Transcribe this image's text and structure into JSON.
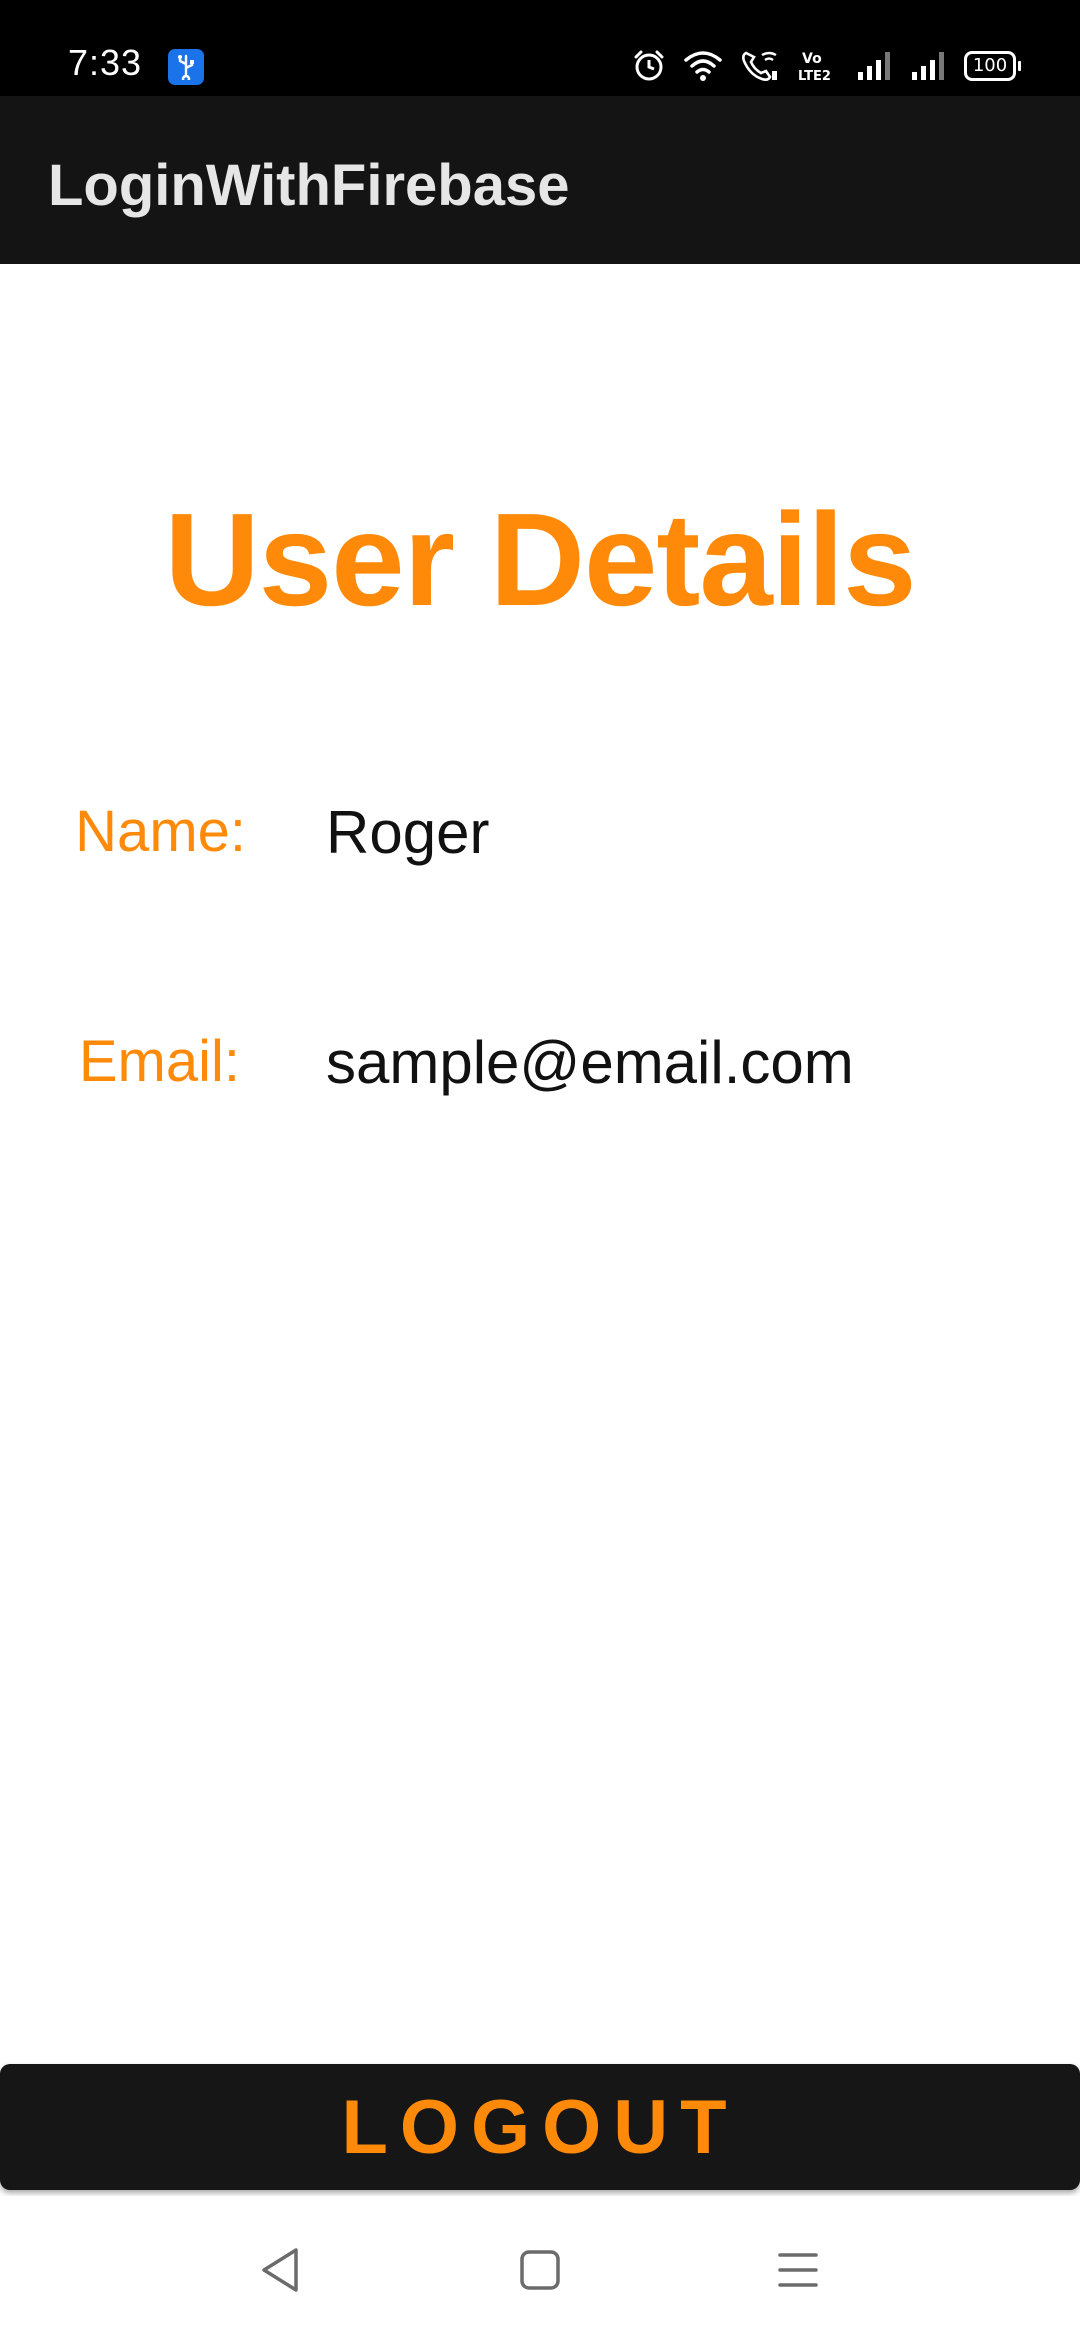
{
  "status_bar": {
    "time": "7:33",
    "battery_level": "100",
    "icons": [
      "usb-icon",
      "alarm-icon",
      "wifi-icon",
      "wifi-calling-icon",
      "volte-icon",
      "signal-icon",
      "signal-icon",
      "battery-icon"
    ]
  },
  "app_bar": {
    "title": "LoginWithFirebase"
  },
  "main": {
    "title": "User Details",
    "fields": [
      {
        "label": "Name:",
        "value": "Roger"
      },
      {
        "label": "Email:",
        "value": "sample@email.com"
      }
    ]
  },
  "logout_button": {
    "label": "LOGOUT"
  },
  "nav_bar": {
    "icons": [
      "back-icon",
      "home-icon",
      "menu-icon"
    ]
  },
  "colors": {
    "accent": "#ff8a0a",
    "app_bar": "#141414",
    "status_bar": "#000000",
    "usb_badge": "#1a73e8"
  }
}
